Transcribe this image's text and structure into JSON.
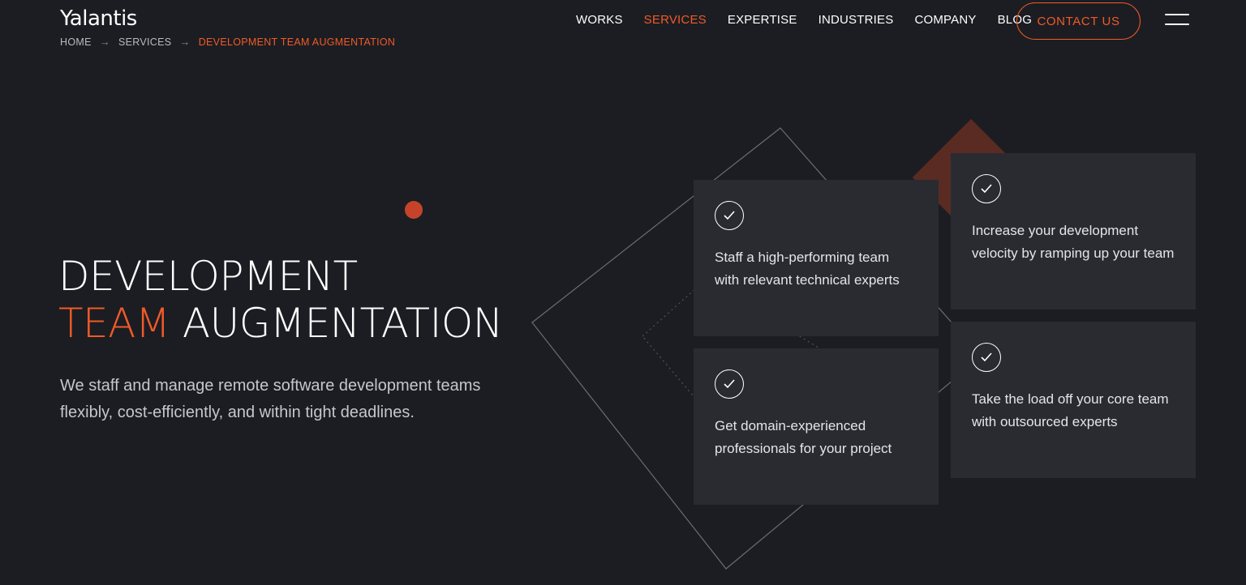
{
  "header": {
    "logo": "Yalantis",
    "breadcrumb": [
      {
        "label": "HOME"
      },
      {
        "label": "SERVICES"
      },
      {
        "label": "DEVELOPMENT TEAM AUGMENTATION"
      }
    ],
    "breadcrumb_separator": "→",
    "nav": [
      {
        "label": "WORKS",
        "active": false
      },
      {
        "label": "SERVICES",
        "active": true
      },
      {
        "label": "EXPERTISE",
        "active": false
      },
      {
        "label": "INDUSTRIES",
        "active": false
      },
      {
        "label": "COMPANY",
        "active": false
      },
      {
        "label": "BLOG",
        "active": false
      }
    ],
    "contact_label": "CONTACT US",
    "menu_icon": "hamburger-menu-icon"
  },
  "hero": {
    "title_line1": "DEVELOPMENT",
    "title_accent": "TEAM",
    "title_rest": "AUGMENTATION",
    "description": "We staff and manage remote software development teams flexibly, cost-efficiently, and within tight deadlines."
  },
  "cards": [
    {
      "icon": "check-circle-icon",
      "text": "Staff a high-performing team with relevant technical experts"
    },
    {
      "icon": "check-circle-icon",
      "text": "Increase your development velocity by ramping up your team"
    },
    {
      "icon": "check-circle-icon",
      "text": "Get domain-experienced professionals for your project"
    },
    {
      "icon": "check-circle-icon",
      "text": "Take the load off your core team with outsourced experts"
    }
  ],
  "colors": {
    "background": "#1c1d22",
    "card": "#292b31",
    "accent": "#f05a28",
    "text": "#ffffff",
    "muted_text": "#c5c7cc"
  }
}
